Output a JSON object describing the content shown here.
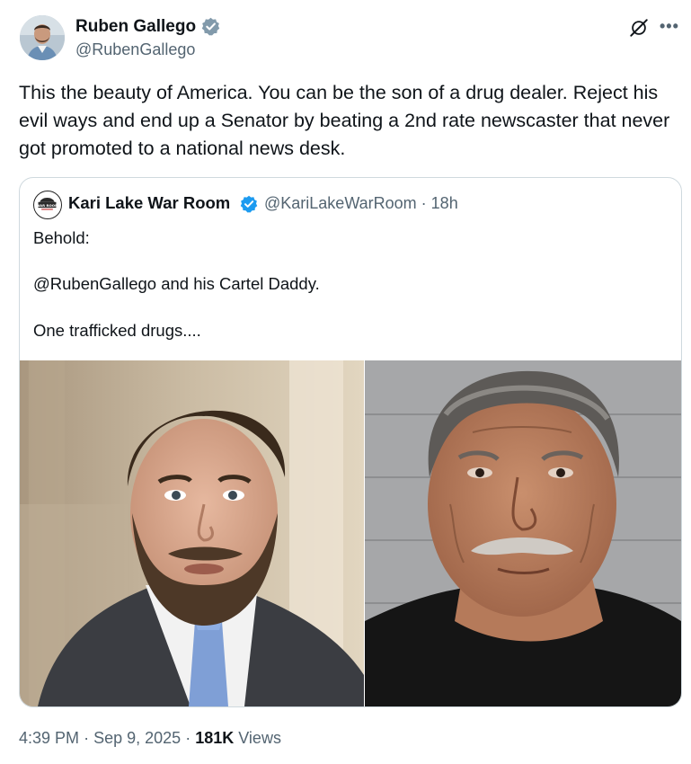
{
  "author": {
    "name": "Ruben Gallego",
    "handle": "@RubenGallego",
    "verified": true
  },
  "tweet": {
    "text": "This the beauty of America. You can be the son of a drug dealer. Reject his evil ways and end up a Senator by beating a 2nd rate newscaster that never got promoted to a national news desk."
  },
  "quoted": {
    "name": "Kari Lake War Room",
    "handle": "@KariLakeWarRoom",
    "time": "· 18h",
    "lines": [
      "Behold:",
      "@RubenGallego and his Cartel Daddy.",
      "One trafficked drugs...."
    ],
    "avatar_text": "WAR ROOM"
  },
  "footer": {
    "time": "4:39 PM",
    "date": "Sep 9, 2025",
    "separator": "·",
    "views_count": "181K",
    "views_label": "Views"
  },
  "icons": {
    "verified": "verified-check-icon",
    "grok": "grok-icon",
    "more": "more-icon"
  },
  "colors": {
    "text_primary": "#0f1419",
    "text_secondary": "#536471",
    "border": "#cfd9de",
    "verified_gray": "#829aab",
    "verified_blue": "#1d9bf0"
  }
}
